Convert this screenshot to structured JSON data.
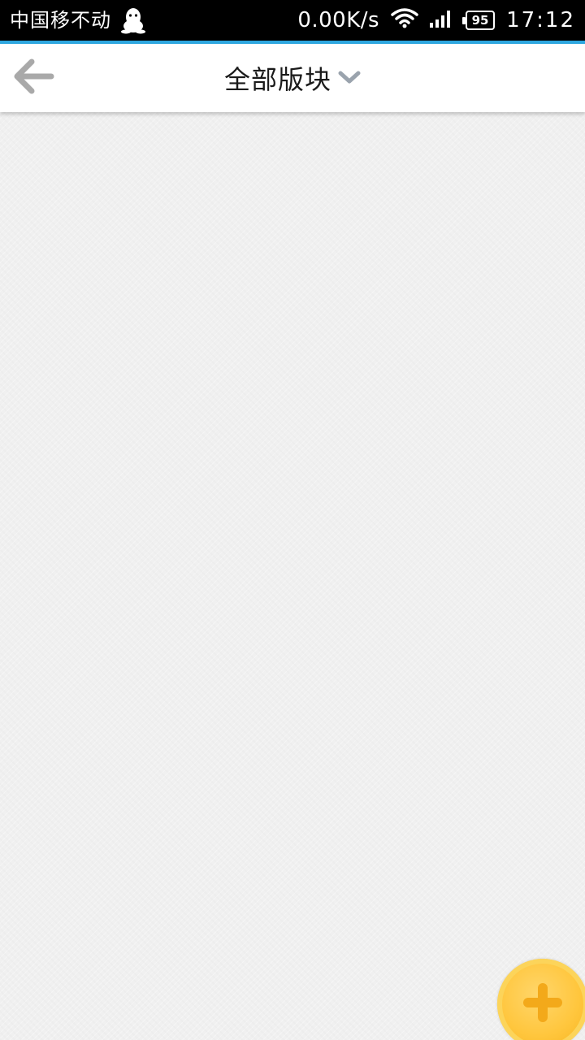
{
  "status_bar": {
    "carrier": "中国移不动",
    "net_speed": "0.00K/s",
    "battery": "95",
    "time": "17:12"
  },
  "header": {
    "title": "全部版块"
  },
  "icons": {
    "back": "arrow-left-icon",
    "dropdown": "chevron-down-icon",
    "add": "plus-icon",
    "qq": "qq-penguin-icon",
    "wifi": "wifi-icon",
    "signal": "signal-icon"
  },
  "colors": {
    "status_bar_bg": "#000000",
    "accent_line": "#2ea7e0",
    "header_bg": "#ffffff",
    "content_bg": "#f0f0f0",
    "fab": "#ffc63d",
    "icon_gray": "#a9a9a9"
  }
}
